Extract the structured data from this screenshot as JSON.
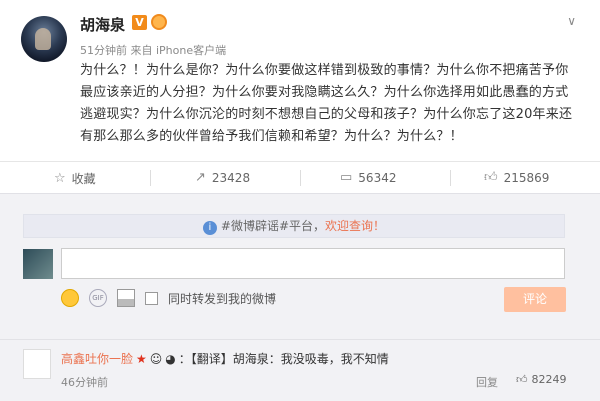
{
  "post": {
    "username": "胡海泉",
    "verified_badge": "V",
    "meta": "51分钟前 来自 iPhone客户端",
    "content": "为什么？！为什么是你？为什么你要做这样错到极致的事情？为什么你不把痛苦予你最应该亲近的人分担？为什么你要对我隐瞒这么久？为什么你选择用如此愚蠢的方式逃避现实？为什么你沉沦的时刻不想想自己的父母和孩子？为什么你忘了这20年来还有那么那么多的伙伴曾给予我们信赖和希望？为什么？为什么？！"
  },
  "actions": {
    "favorite_label": "收藏",
    "repost_count": "23428",
    "comment_count": "56342",
    "like_count": "215869"
  },
  "comment_panel": {
    "notice_prefix": "#微博辟谣#平台，",
    "notice_link": "欢迎查询！",
    "forward_checkbox_label": "同时转发到我的微博",
    "submit_label": "评论"
  },
  "comment": {
    "user": "高鑫吐你一脸",
    "text": "：【翻译】胡海泉：我没吸毒，我不知情",
    "time": "46分钟前",
    "reply_label": "回复",
    "like_count": "82249"
  },
  "icons": {
    "chevron": "chevron-down-icon",
    "star": "star-icon",
    "repost": "repost-icon",
    "comment": "comment-icon",
    "like": "thumbs-up-icon"
  }
}
